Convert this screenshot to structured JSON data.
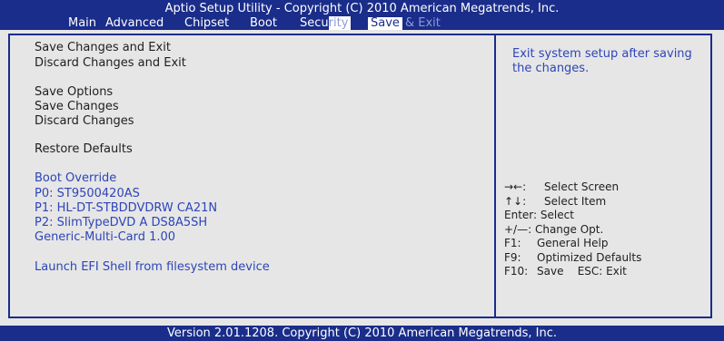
{
  "header": {
    "title": "Aptio Setup Utility - Copyright (C) 2010 American Megatrends, Inc.",
    "tabs": [
      "Main",
      "Advanced",
      "Chipset",
      "Boot",
      "Security",
      "Save & Exit"
    ],
    "selected_tab": "Save & Exit",
    "partial_tab_left": "Secu",
    "partial_tab_hidden": "rity",
    "save_part": "Save",
    "exit_part": "& Exit"
  },
  "menu": {
    "items": [
      "Save Changes and Exit",
      "Discard Changes and Exit",
      "Save Options",
      "Save Changes",
      "Discard Changes",
      "Restore Defaults",
      "Boot Override",
      "P0:  ST9500420AS",
      "P1:  HL-DT-STBDDVDRW CA21N",
      "P2:  SlimTypeDVD A DS8A5SH",
      "Generic-Multi-Card 1.00",
      "Launch EFI Shell from filesystem device"
    ]
  },
  "help": {
    "text": "Exit system setup after saving the changes."
  },
  "keys": [
    {
      "key": "→←:",
      "desc": "Select Screen"
    },
    {
      "key": "↑↓:",
      "desc": "Select Item"
    },
    {
      "key": "Enter:",
      "desc": "Select"
    },
    {
      "key": "+/—:",
      "desc": "Change Opt."
    },
    {
      "key": "F1:",
      "desc": "General Help"
    },
    {
      "key": "F9:",
      "desc": "Optimized Defaults"
    },
    {
      "key": "F10:",
      "desc": "Save    ESC: Exit"
    }
  ],
  "footer": {
    "text": "Version 2.01.1208. Copyright (C) 2010 American Megatrends, Inc."
  },
  "colors": {
    "bar": "#1a2d8a",
    "panel": "#e6e6e6",
    "highlight_text": "#2e45b8",
    "normal_text": "#1e1e1e"
  }
}
